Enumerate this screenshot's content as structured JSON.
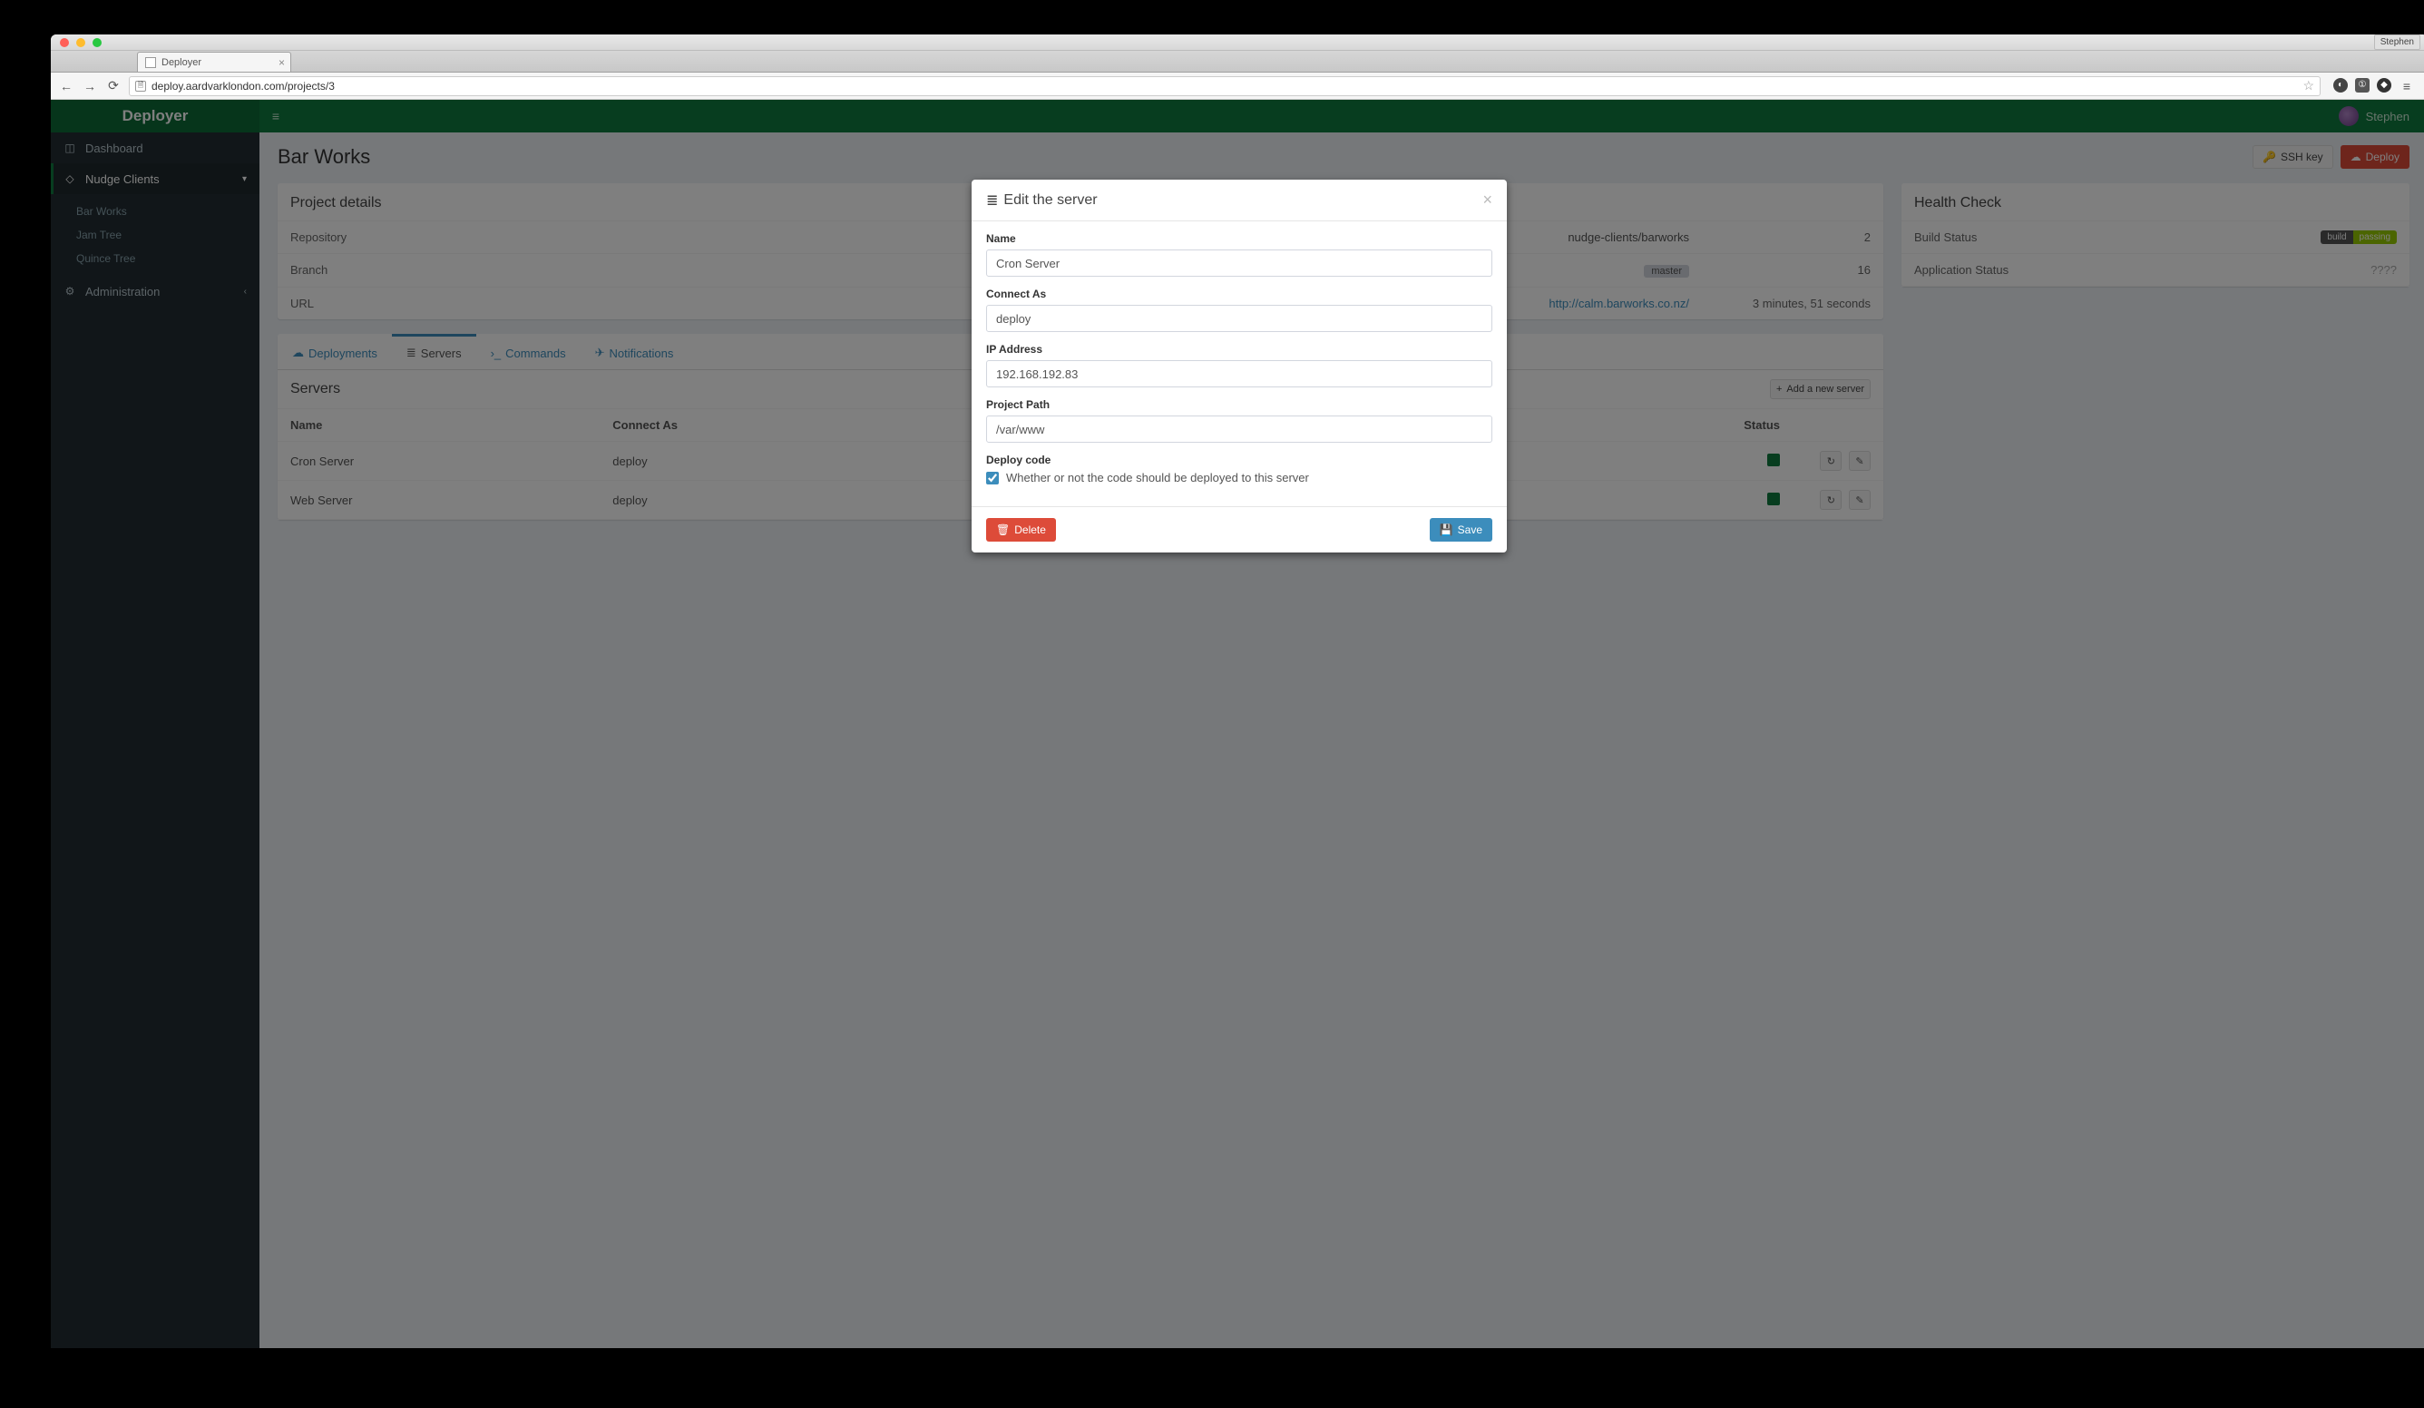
{
  "browser": {
    "profile": "Stephen",
    "tab_title": "Deployer",
    "url": "deploy.aardvarklondon.com/projects/3"
  },
  "app": {
    "brand": "Deployer",
    "user": "Stephen"
  },
  "sidebar": {
    "dashboard": "Dashboard",
    "group": "Nudge Clients",
    "projects": [
      "Bar Works",
      "Jam Tree",
      "Quince Tree"
    ],
    "admin": "Administration"
  },
  "page": {
    "title": "Bar Works",
    "ssh_key": "SSH key",
    "deploy": "Deploy"
  },
  "project_details": {
    "title": "Project details",
    "rows": {
      "repo_label": "Repository",
      "repo_value": "nudge-clients/barworks",
      "repo_r_value": "2",
      "branch_label": "Branch",
      "branch_value": "master",
      "branch_r_value": "16",
      "url_label": "URL",
      "url_value": "http://calm.barworks.co.nz/",
      "url_r_value": "3 minutes, 51 seconds"
    }
  },
  "tabs": {
    "deployments": "Deployments",
    "servers": "Servers",
    "commands": "Commands",
    "notifications": "Notifications"
  },
  "servers": {
    "title": "Servers",
    "add": "Add a new server",
    "headers": {
      "name": "Name",
      "connect": "Connect As",
      "status": "Status"
    },
    "rows": [
      {
        "name": "Cron Server",
        "connect": "deploy"
      },
      {
        "name": "Web Server",
        "connect": "deploy"
      }
    ]
  },
  "health": {
    "title": "Health Check",
    "build_label": "Build Status",
    "build_badge_l": "build",
    "build_badge_r": "passing",
    "app_label": "Application Status",
    "app_value": "????"
  },
  "modal": {
    "title": "Edit the server",
    "name_label": "Name",
    "name_value": "Cron Server",
    "connect_label": "Connect As",
    "connect_value": "deploy",
    "ip_label": "IP Address",
    "ip_value": "192.168.192.83",
    "path_label": "Project Path",
    "path_value": "/var/www",
    "deploy_label": "Deploy code",
    "deploy_help": "Whether or not the code should be deployed to this server",
    "delete": "Delete",
    "save": "Save"
  }
}
